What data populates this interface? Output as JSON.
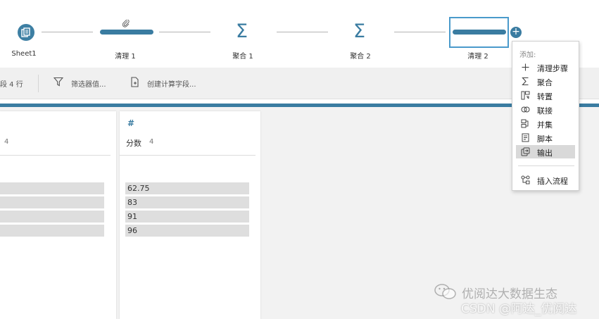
{
  "flow": {
    "nodes": [
      {
        "label": "Sheet1",
        "icon": "sheet-icon"
      },
      {
        "label": "清理 1",
        "icon": "clean-step-icon"
      },
      {
        "label": "聚合 1",
        "icon": "sigma-icon"
      },
      {
        "label": "聚合 2",
        "icon": "sigma-icon"
      },
      {
        "label": "清理 2",
        "icon": "clean-step-icon"
      }
    ],
    "add_icon": "plus-circle-icon"
  },
  "toolbar": {
    "fields_info": "段  4 行",
    "filter_label": "筛选器值...",
    "calc_label": "创建计算字段..."
  },
  "profile": {
    "left_card": {
      "count": "4"
    },
    "right_card": {
      "type_symbol": "#",
      "field_name": "分数",
      "count": "4",
      "values": [
        "62.75",
        "83",
        "91",
        "96"
      ]
    }
  },
  "menu": {
    "header": "添加:",
    "items": [
      {
        "label": "清理步骤",
        "icon": "plus-icon"
      },
      {
        "label": "聚合",
        "icon": "sigma-icon"
      },
      {
        "label": "转置",
        "icon": "pivot-icon"
      },
      {
        "label": "联接",
        "icon": "join-icon"
      },
      {
        "label": "并集",
        "icon": "union-icon"
      },
      {
        "label": "脚本",
        "icon": "script-icon"
      },
      {
        "label": "输出",
        "icon": "output-icon"
      },
      {
        "label": "插入流程",
        "icon": "insert-flow-icon"
      }
    ]
  },
  "watermark": {
    "line1": "优阅达大数据生态",
    "line2": "CSDN @阿达_优阅达"
  },
  "colors": {
    "accent": "#3a7ca1",
    "selected_border": "#4a9acb",
    "value_bar": "#dedede",
    "menu_hover": "#d9d9d9"
  }
}
